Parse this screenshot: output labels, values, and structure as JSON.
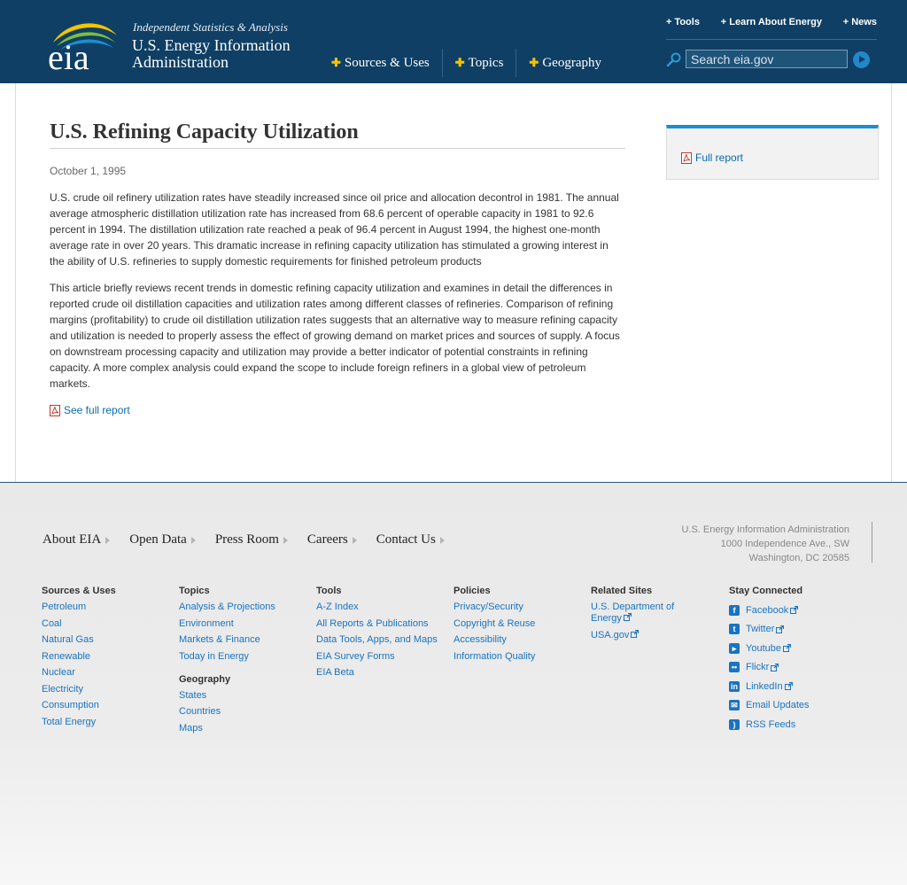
{
  "header": {
    "tagline": "Independent Statistics & Analysis",
    "agency_line1": "U.S. Energy Information",
    "agency_line2": "Administration",
    "nav": [
      {
        "label": "Sources & Uses"
      },
      {
        "label": "Topics"
      },
      {
        "label": "Geography"
      }
    ],
    "util": [
      {
        "label": "Tools"
      },
      {
        "label": "Learn About Energy"
      },
      {
        "label": "News"
      }
    ],
    "search_placeholder": "Search eia.gov"
  },
  "article": {
    "title": "U.S. Refining Capacity Utilization",
    "date": "October 1, 1995",
    "paragraph1": "U.S. crude oil refinery utilization rates have steadily increased since oil price and allocation decontrol in 1981. The annual average atmospheric distillation utilization rate has increased from 68.6 percent of operable capacity in 1981 to 92.6 percent in 1994. The distillation utilization rate reached a peak of 96.4 percent in August 1994, the highest one-month average rate in over 20 years. This dramatic increase in refining capacity utilization has stimulated a growing interest in the ability of U.S. refineries to supply domestic requirements for finished petroleum products",
    "paragraph2": "This article briefly reviews recent trends in domestic refining capacity utilization and examines in detail the differences in reported crude oil distillation capacities and utilization rates among different classes of refineries. Comparison of refining margins (profitability) to crude oil distillation utilization rates suggests that an alternative way to measure refining capacity and utilization is needed to properly assess the effect of growing demand on market prices and sources of supply. A focus on downstream processing capacity and utilization may provide a better indicator of potential constraints in refining capacity. A more complex analysis could expand the scope to include foreign refiners in a global view of petroleum markets.",
    "see_full_report": "See full report"
  },
  "sidebar": {
    "full_report": "Full report"
  },
  "colors": {
    "header_bg": "#0f3f64",
    "accent_blue": "#1b8fcf",
    "link": "#1a73c0",
    "plus_yellow": "#f4c400"
  },
  "footer": {
    "nav": [
      {
        "label": "About EIA"
      },
      {
        "label": "Open Data"
      },
      {
        "label": "Press Room"
      },
      {
        "label": "Careers"
      },
      {
        "label": "Contact Us"
      }
    ],
    "address": {
      "line1": "U.S. Energy Information Administration",
      "line2": "1000 Independence Ave., SW",
      "line3": "Washington, DC 20585"
    },
    "sources": {
      "title": "Sources & Uses",
      "links": [
        "Petroleum",
        "Coal",
        "Natural Gas",
        "Renewable",
        "Nuclear",
        "Electricity",
        "Consumption",
        "Total Energy"
      ]
    },
    "topics": {
      "title": "Topics",
      "links": [
        "Analysis & Projections",
        "Environment",
        "Markets & Finance",
        "Today in Energy"
      ]
    },
    "geography": {
      "title": "Geography",
      "links": [
        "States",
        "Countries",
        "Maps"
      ]
    },
    "tools": {
      "title": "Tools",
      "links": [
        "A-Z Index",
        "All Reports & Publications",
        "Data Tools, Apps, and Maps",
        "EIA Survey Forms",
        "EIA Beta"
      ]
    },
    "policies": {
      "title": "Policies",
      "links": [
        "Privacy/Security",
        "Copyright & Reuse",
        "Accessibility",
        "Information Quality"
      ]
    },
    "related": {
      "title": "Related Sites",
      "link1": "U.S. Department of Energy",
      "link2": "USA.gov"
    },
    "stay_connected": {
      "title": "Stay Connected",
      "links": [
        {
          "label": "Facebook",
          "icon": "facebook-icon"
        },
        {
          "label": "Twitter",
          "icon": "twitter-icon"
        },
        {
          "label": "Youtube",
          "icon": "youtube-icon"
        },
        {
          "label": "Flickr",
          "icon": "flickr-icon"
        },
        {
          "label": "LinkedIn",
          "icon": "linkedin-icon"
        },
        {
          "label": "Email Updates",
          "icon": "email-icon"
        },
        {
          "label": "RSS Feeds",
          "icon": "rss-icon"
        }
      ]
    }
  }
}
